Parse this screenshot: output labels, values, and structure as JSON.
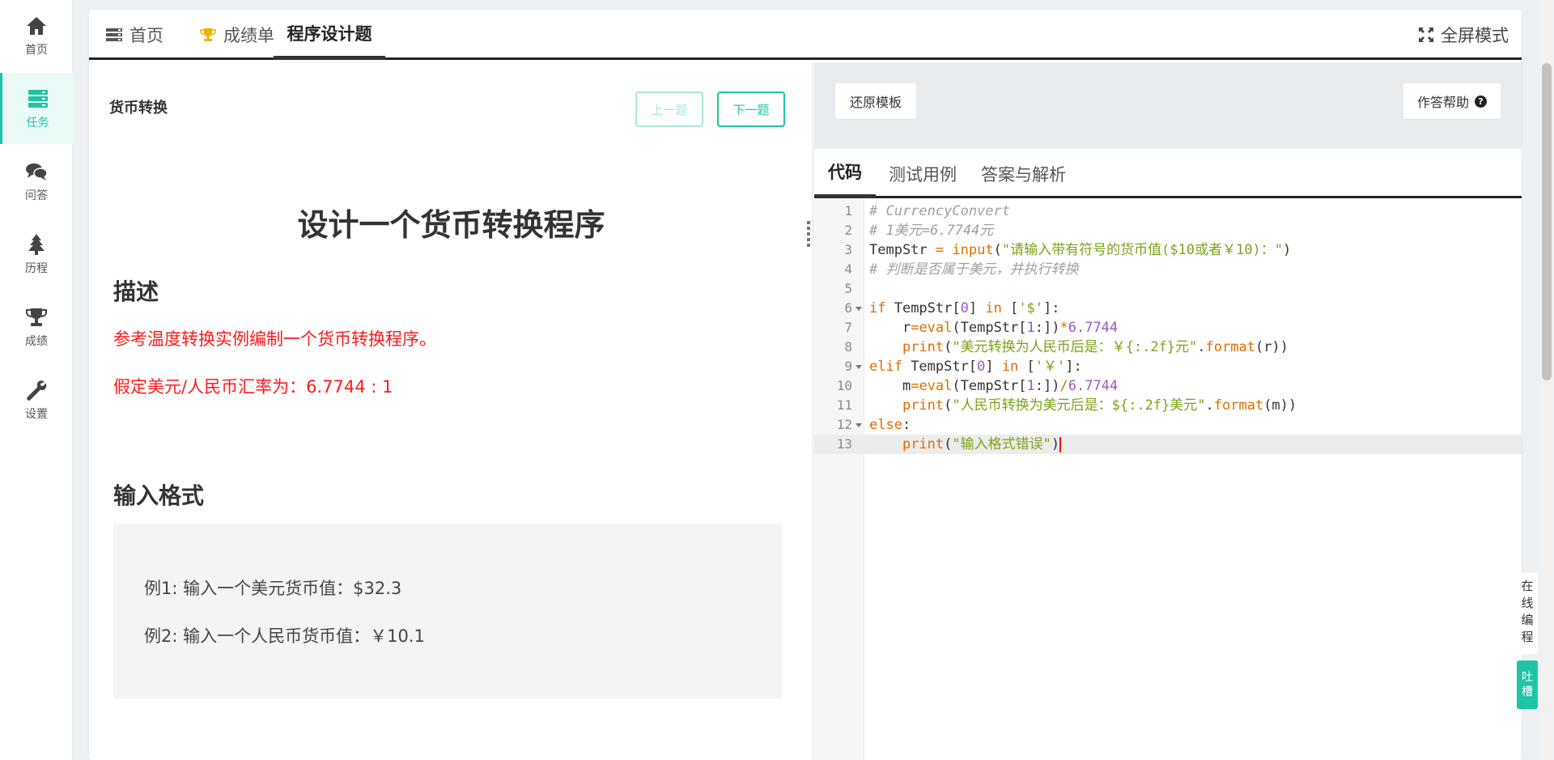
{
  "sidebar": {
    "items": [
      {
        "label": "首页",
        "icon": "home-icon"
      },
      {
        "label": "任务",
        "icon": "tasks-icon",
        "active": true
      },
      {
        "label": "问答",
        "icon": "comments-icon"
      },
      {
        "label": "历程",
        "icon": "tree-icon"
      },
      {
        "label": "成绩",
        "icon": "trophy-icon"
      },
      {
        "label": "设置",
        "icon": "wrench-icon"
      }
    ]
  },
  "topbar": {
    "tabs": [
      {
        "label": "首页",
        "icon": "list-icon"
      },
      {
        "label": "成绩单",
        "icon": "trophy-icon"
      },
      {
        "label": "程序设计题",
        "active": true
      }
    ],
    "fullscreen_label": "全屏模式"
  },
  "problem": {
    "name": "货币转换",
    "prev_label": "上一题",
    "next_label": "下一题",
    "title": "设计一个货币转换程序",
    "description_heading": "描述",
    "description_lines": [
      "参考温度转换实例编制一个货币转换程序。",
      "假定美元/人民币汇率为：6.7744 : 1"
    ],
    "input_heading": "输入格式",
    "examples": [
      "例1: 输入一个美元货币值：$32.3",
      "例2: 输入一个人民币货币值：￥10.1"
    ]
  },
  "editor": {
    "restore_label": "还原模板",
    "help_label": "作答帮助",
    "tabs": [
      "代码",
      "测试用例",
      "答案与解析"
    ],
    "active_tab": "代码",
    "current_line": 13,
    "lines": [
      "# CurrencyConvert",
      "# 1美元=6.7744元",
      "TempStr = input(\"请输入带有符号的货币值($10或者￥10)：\")",
      "# 判断是否属于美元，并执行转换",
      "",
      "if TempStr[0] in ['$']:",
      "    r=eval(TempStr[1:])*6.7744",
      "    print(\"美元转换为人民币后是：￥{:.2f}元\".format(r))",
      "elif TempStr[0] in ['￥']:",
      "    m=eval(TempStr[1:])/6.7744",
      "    print(\"人民币转换为美元后是：${:.2f}美元\".format(m))",
      "else:",
      "    print(\"输入格式错误\")"
    ]
  },
  "floating": {
    "online_coding_label": "在线编程",
    "feedback_label": "吐槽"
  },
  "colors": {
    "accent": "#1ec4a5",
    "warning_text": "#ff1a1a",
    "keyword": "#e06c00",
    "string": "#7ea11a",
    "number": "#9a59c4",
    "comment": "#a0a0a0"
  }
}
